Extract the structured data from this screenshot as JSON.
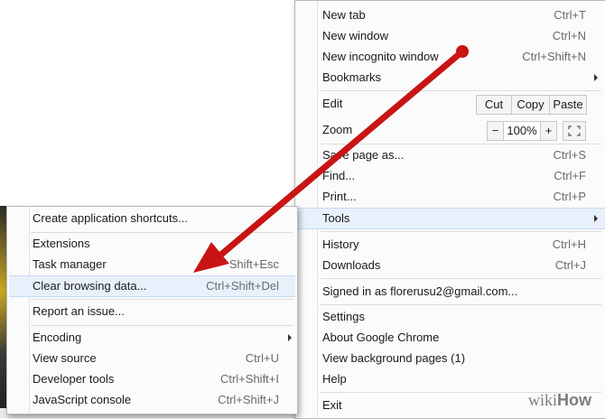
{
  "chrome_menu": {
    "new_tab": {
      "label": "New tab",
      "shortcut": "Ctrl+T"
    },
    "new_window": {
      "label": "New window",
      "shortcut": "Ctrl+N"
    },
    "new_incognito": {
      "label": "New incognito window",
      "shortcut": "Ctrl+Shift+N"
    },
    "bookmarks": {
      "label": "Bookmarks"
    },
    "edit": {
      "label": "Edit",
      "cut": "Cut",
      "copy": "Copy",
      "paste": "Paste"
    },
    "zoom": {
      "label": "Zoom",
      "minus": "−",
      "level": "100%",
      "plus": "+"
    },
    "save_page": {
      "label": "Save page as...",
      "shortcut": "Ctrl+S"
    },
    "find": {
      "label": "Find...",
      "shortcut": "Ctrl+F"
    },
    "print": {
      "label": "Print...",
      "shortcut": "Ctrl+P"
    },
    "tools": {
      "label": "Tools"
    },
    "history": {
      "label": "History",
      "shortcut": "Ctrl+H"
    },
    "downloads": {
      "label": "Downloads",
      "shortcut": "Ctrl+J"
    },
    "signed_in": {
      "label": "Signed in as florerusu2@gmail.com..."
    },
    "settings": {
      "label": "Settings"
    },
    "about": {
      "label": "About Google Chrome"
    },
    "background_pages": {
      "label": "View background pages (1)"
    },
    "help": {
      "label": "Help"
    },
    "exit": {
      "label": "Exit"
    }
  },
  "tools_menu": {
    "create_shortcuts": {
      "label": "Create application shortcuts..."
    },
    "extensions": {
      "label": "Extensions"
    },
    "task_manager": {
      "label": "Task manager",
      "shortcut": "Shift+Esc"
    },
    "clear_browsing": {
      "label": "Clear browsing data...",
      "shortcut": "Ctrl+Shift+Del"
    },
    "report_issue": {
      "label": "Report an issue..."
    },
    "encoding": {
      "label": "Encoding"
    },
    "view_source": {
      "label": "View source",
      "shortcut": "Ctrl+U"
    },
    "developer_tools": {
      "label": "Developer tools",
      "shortcut": "Ctrl+Shift+I"
    },
    "js_console": {
      "label": "JavaScript console",
      "shortcut": "Ctrl+Shift+J"
    }
  },
  "watermark": {
    "prefix": "wiki",
    "suffix": "How"
  },
  "annotation": {
    "arrow_color": "#c81414"
  },
  "icons": [
    "fullscreen-icon",
    "submenu-arrow-icon"
  ]
}
